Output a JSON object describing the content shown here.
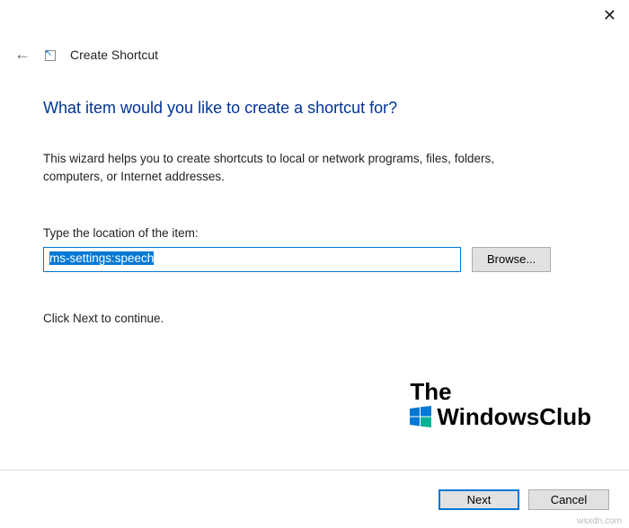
{
  "header": {
    "title": "Create Shortcut"
  },
  "main": {
    "heading": "What item would you like to create a shortcut for?",
    "description": "This wizard helps you to create shortcuts to local or network programs, files, folders, computers, or Internet addresses.",
    "input_label": "Type the location of the item:",
    "input_value": "ms-settings:speech",
    "browse_label": "Browse...",
    "continue_text": "Click Next to continue."
  },
  "buttons": {
    "next": "Next",
    "cancel": "Cancel"
  },
  "watermark": {
    "line1": "The",
    "line2": "WindowsClub"
  },
  "origin": "wsxdn.com",
  "colors": {
    "heading": "#003399",
    "accent": "#0078d4",
    "logo_blue": "#0078d4",
    "logo_teal": "#00b294",
    "button_face": "#e1e1e1"
  }
}
